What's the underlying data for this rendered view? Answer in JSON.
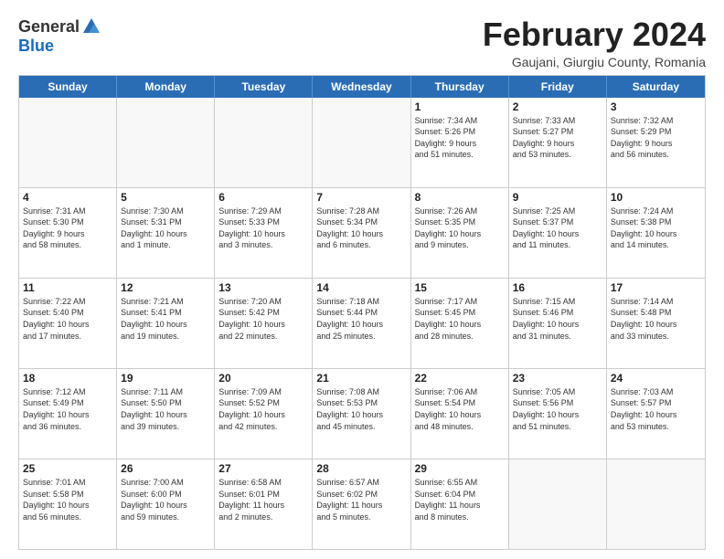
{
  "header": {
    "logo_general": "General",
    "logo_blue": "Blue",
    "title": "February 2024",
    "location": "Gaujani, Giurgiu County, Romania"
  },
  "weekdays": [
    "Sunday",
    "Monday",
    "Tuesday",
    "Wednesday",
    "Thursday",
    "Friday",
    "Saturday"
  ],
  "rows": [
    [
      {
        "day": "",
        "info": ""
      },
      {
        "day": "",
        "info": ""
      },
      {
        "day": "",
        "info": ""
      },
      {
        "day": "",
        "info": ""
      },
      {
        "day": "1",
        "info": "Sunrise: 7:34 AM\nSunset: 5:26 PM\nDaylight: 9 hours\nand 51 minutes."
      },
      {
        "day": "2",
        "info": "Sunrise: 7:33 AM\nSunset: 5:27 PM\nDaylight: 9 hours\nand 53 minutes."
      },
      {
        "day": "3",
        "info": "Sunrise: 7:32 AM\nSunset: 5:29 PM\nDaylight: 9 hours\nand 56 minutes."
      }
    ],
    [
      {
        "day": "4",
        "info": "Sunrise: 7:31 AM\nSunset: 5:30 PM\nDaylight: 9 hours\nand 58 minutes."
      },
      {
        "day": "5",
        "info": "Sunrise: 7:30 AM\nSunset: 5:31 PM\nDaylight: 10 hours\nand 1 minute."
      },
      {
        "day": "6",
        "info": "Sunrise: 7:29 AM\nSunset: 5:33 PM\nDaylight: 10 hours\nand 3 minutes."
      },
      {
        "day": "7",
        "info": "Sunrise: 7:28 AM\nSunset: 5:34 PM\nDaylight: 10 hours\nand 6 minutes."
      },
      {
        "day": "8",
        "info": "Sunrise: 7:26 AM\nSunset: 5:35 PM\nDaylight: 10 hours\nand 9 minutes."
      },
      {
        "day": "9",
        "info": "Sunrise: 7:25 AM\nSunset: 5:37 PM\nDaylight: 10 hours\nand 11 minutes."
      },
      {
        "day": "10",
        "info": "Sunrise: 7:24 AM\nSunset: 5:38 PM\nDaylight: 10 hours\nand 14 minutes."
      }
    ],
    [
      {
        "day": "11",
        "info": "Sunrise: 7:22 AM\nSunset: 5:40 PM\nDaylight: 10 hours\nand 17 minutes."
      },
      {
        "day": "12",
        "info": "Sunrise: 7:21 AM\nSunset: 5:41 PM\nDaylight: 10 hours\nand 19 minutes."
      },
      {
        "day": "13",
        "info": "Sunrise: 7:20 AM\nSunset: 5:42 PM\nDaylight: 10 hours\nand 22 minutes."
      },
      {
        "day": "14",
        "info": "Sunrise: 7:18 AM\nSunset: 5:44 PM\nDaylight: 10 hours\nand 25 minutes."
      },
      {
        "day": "15",
        "info": "Sunrise: 7:17 AM\nSunset: 5:45 PM\nDaylight: 10 hours\nand 28 minutes."
      },
      {
        "day": "16",
        "info": "Sunrise: 7:15 AM\nSunset: 5:46 PM\nDaylight: 10 hours\nand 31 minutes."
      },
      {
        "day": "17",
        "info": "Sunrise: 7:14 AM\nSunset: 5:48 PM\nDaylight: 10 hours\nand 33 minutes."
      }
    ],
    [
      {
        "day": "18",
        "info": "Sunrise: 7:12 AM\nSunset: 5:49 PM\nDaylight: 10 hours\nand 36 minutes."
      },
      {
        "day": "19",
        "info": "Sunrise: 7:11 AM\nSunset: 5:50 PM\nDaylight: 10 hours\nand 39 minutes."
      },
      {
        "day": "20",
        "info": "Sunrise: 7:09 AM\nSunset: 5:52 PM\nDaylight: 10 hours\nand 42 minutes."
      },
      {
        "day": "21",
        "info": "Sunrise: 7:08 AM\nSunset: 5:53 PM\nDaylight: 10 hours\nand 45 minutes."
      },
      {
        "day": "22",
        "info": "Sunrise: 7:06 AM\nSunset: 5:54 PM\nDaylight: 10 hours\nand 48 minutes."
      },
      {
        "day": "23",
        "info": "Sunrise: 7:05 AM\nSunset: 5:56 PM\nDaylight: 10 hours\nand 51 minutes."
      },
      {
        "day": "24",
        "info": "Sunrise: 7:03 AM\nSunset: 5:57 PM\nDaylight: 10 hours\nand 53 minutes."
      }
    ],
    [
      {
        "day": "25",
        "info": "Sunrise: 7:01 AM\nSunset: 5:58 PM\nDaylight: 10 hours\nand 56 minutes."
      },
      {
        "day": "26",
        "info": "Sunrise: 7:00 AM\nSunset: 6:00 PM\nDaylight: 10 hours\nand 59 minutes."
      },
      {
        "day": "27",
        "info": "Sunrise: 6:58 AM\nSunset: 6:01 PM\nDaylight: 11 hours\nand 2 minutes."
      },
      {
        "day": "28",
        "info": "Sunrise: 6:57 AM\nSunset: 6:02 PM\nDaylight: 11 hours\nand 5 minutes."
      },
      {
        "day": "29",
        "info": "Sunrise: 6:55 AM\nSunset: 6:04 PM\nDaylight: 11 hours\nand 8 minutes."
      },
      {
        "day": "",
        "info": ""
      },
      {
        "day": "",
        "info": ""
      }
    ]
  ]
}
